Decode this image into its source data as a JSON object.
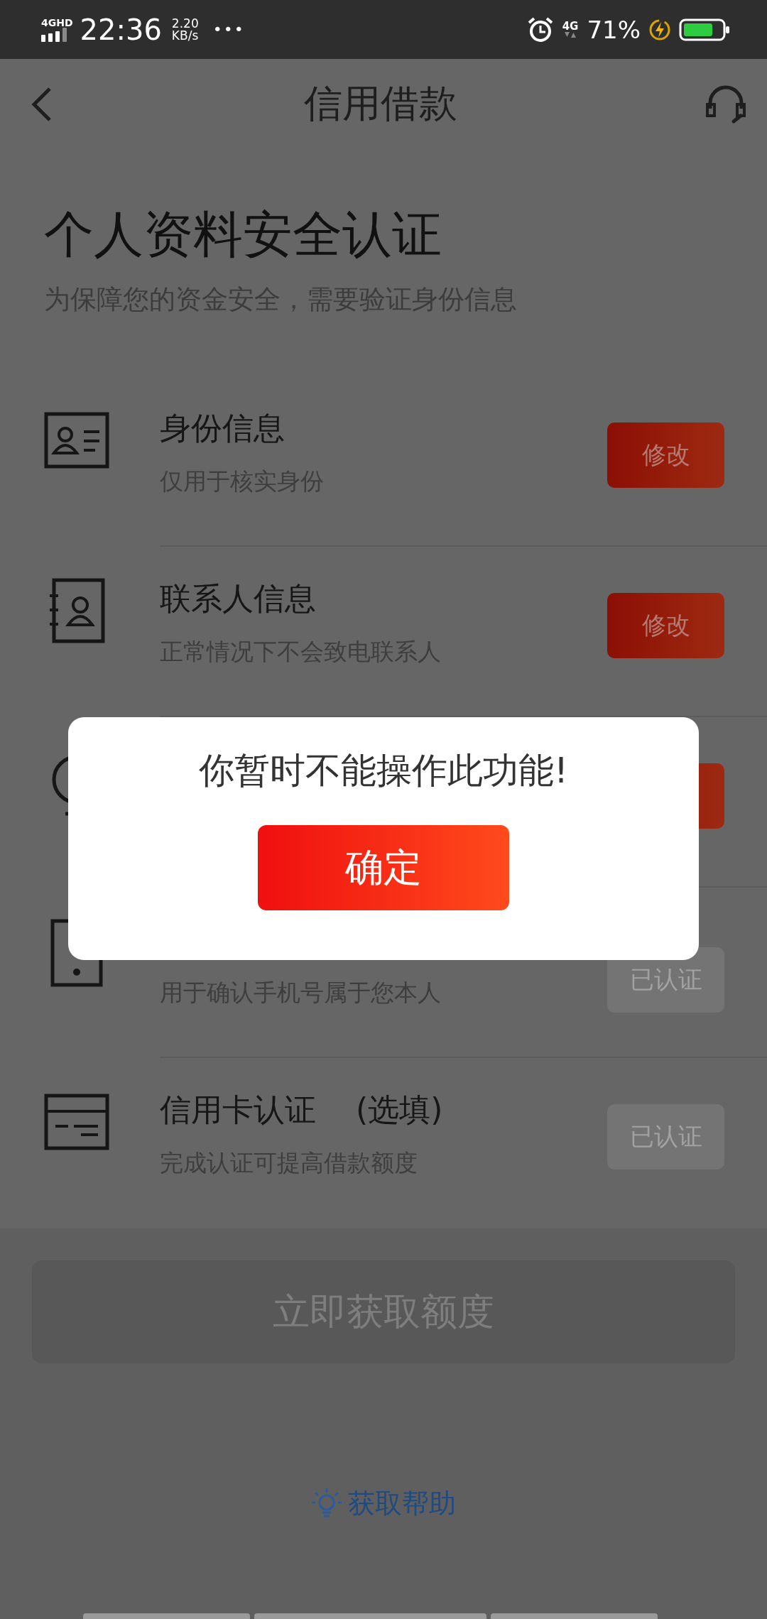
{
  "status_bar": {
    "network": "4GHD",
    "time": "22:36",
    "speed_value": "2.20",
    "speed_unit": "KB/s",
    "more": "•••",
    "cell": "4G",
    "battery": "71%"
  },
  "nav": {
    "title": "信用借款"
  },
  "header": {
    "title": "个人资料安全认证",
    "subtitle": "为保障您的资金安全，需要验证身份信息"
  },
  "rows": [
    {
      "title": "身份信息",
      "subtitle": "仅用于核实身份",
      "button": {
        "label": "修改",
        "kind": "edit"
      }
    },
    {
      "title": "联系人信息",
      "subtitle": "正常情况下不会致电联系人",
      "button": {
        "label": "修改",
        "kind": "edit"
      }
    },
    {
      "button": {
        "kind": "edit"
      }
    },
    {
      "subtitle": "用于确认手机号属于您本人",
      "button": {
        "label": "已认证",
        "kind": "done"
      }
    },
    {
      "title": "信用卡认证",
      "tag": "(选填)",
      "subtitle": "完成认证可提高借款额度",
      "button": {
        "label": "已认证",
        "kind": "done"
      }
    }
  ],
  "submit": {
    "label": "立即获取额度",
    "disabled": true
  },
  "help": {
    "label": "获取帮助"
  },
  "dialog": {
    "message": "你暂时不能操作此功能!",
    "confirm": "确定"
  }
}
